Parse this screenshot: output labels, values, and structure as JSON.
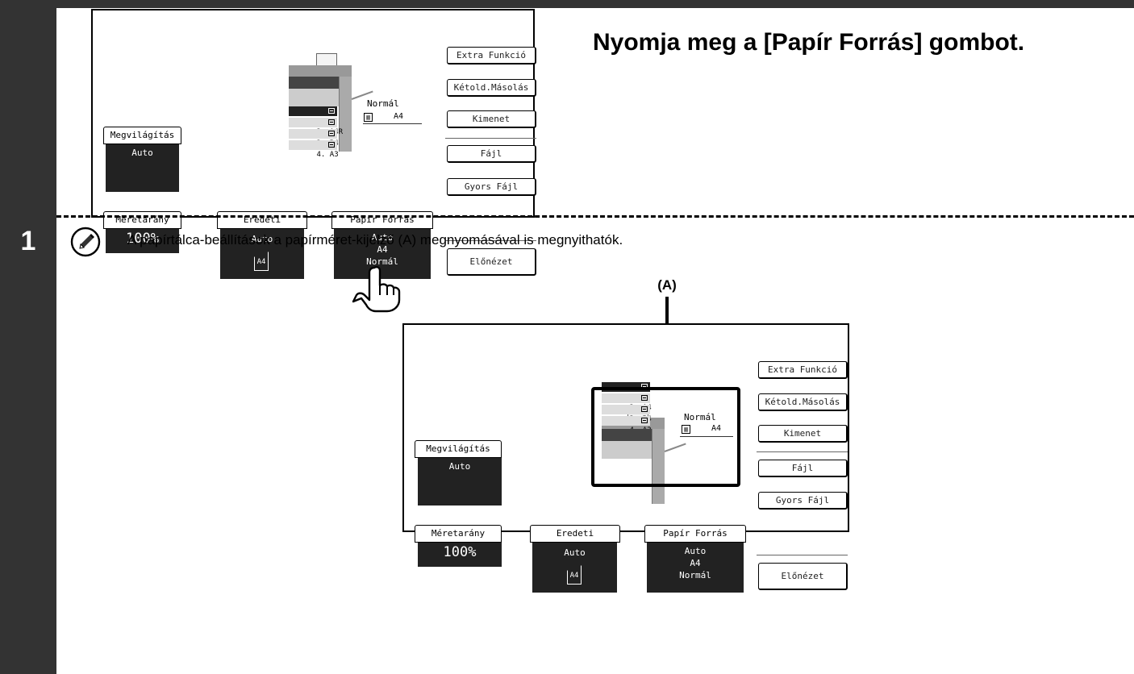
{
  "step": {
    "number": "1"
  },
  "heading": "Nyomja meg a [Papír Forrás] gombot.",
  "note": {
    "icon": "pencil-icon",
    "text": "A papírtálca-beállítások a papírméret-kijelző (A) megnyomásával is megnyithatók."
  },
  "callout": {
    "label": "(A)"
  },
  "panel": {
    "right_buttons": {
      "extra": "Extra Funkció",
      "duplex": "Kétold.Másolás",
      "output": "Kimenet",
      "file": "Fájl",
      "quick_file": "Gyors Fájl",
      "preview": "Előnézet"
    },
    "exposure": {
      "label": "Megvilágítás",
      "value": "Auto"
    },
    "ratio": {
      "label": "Méretarány",
      "value": "100%"
    },
    "original": {
      "label": "Eredeti",
      "value": "Auto",
      "size": "A4"
    },
    "paper_source": {
      "label": "Papír Forrás",
      "line1": "Auto",
      "line2": "A4",
      "line3": "Normál"
    },
    "bypass": {
      "type": "Normál",
      "size": "A4"
    },
    "trays": [
      {
        "num": "1.",
        "size": "A4"
      },
      {
        "num": "2.",
        "size": "A4R"
      },
      {
        "num": "3.",
        "size": "B4"
      },
      {
        "num": "4.",
        "size": "A3"
      }
    ]
  }
}
